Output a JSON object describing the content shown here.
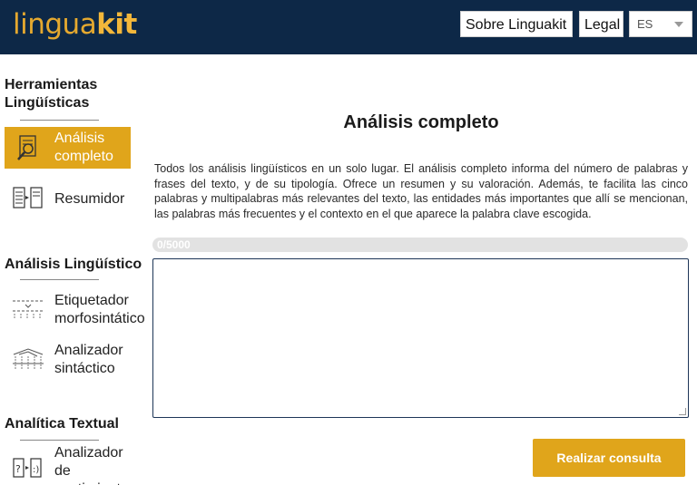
{
  "header": {
    "logo_part1": "lingua",
    "logo_part2": "kit",
    "about_label": "Sobre Linguakit",
    "legal_label": "Legal",
    "language_selected": "ES"
  },
  "sidebar": {
    "sections": [
      {
        "title": "Herramientas\nLingüísticas",
        "items": [
          {
            "label": "Análisis\ncompleto",
            "icon": "magnifier-document-icon",
            "active": true
          },
          {
            "label": "Resumidor",
            "icon": "documents-arrow-icon",
            "active": false
          }
        ]
      },
      {
        "title": "Análisis Lingüístico",
        "items": [
          {
            "label": "Etiquetador\nmorfosintático",
            "icon": "tagger-icon",
            "active": false
          },
          {
            "label": "Analizador\nsintáctico",
            "icon": "parse-tree-icon",
            "active": false
          }
        ]
      },
      {
        "title": "Analítica Textual",
        "items": [
          {
            "label": "Analizador\nde\nsentimiento",
            "icon": "sentiment-icon",
            "active": false
          }
        ]
      }
    ]
  },
  "main": {
    "title": "Análisis completo",
    "description": "Todos los análisis lingüísticos en un solo lugar. El análisis completo informa del número de palabras y frases del texto, y de su tipología. Ofrece un resumen y su valoración. Además, te facilita las cinco palabras y multipalabras más relevantes del texto, las entidades más importantes que allí se mencionan, las palabras más frecuentes y el contexto en el que aparece la palabra clave escogida.",
    "counter": "0/5000",
    "text_value": "",
    "submit_label": "Realizar consulta"
  },
  "colors": {
    "header_bg": "#0d2847",
    "accent": "#e0a51b",
    "logo_color": "#f3b73a"
  }
}
